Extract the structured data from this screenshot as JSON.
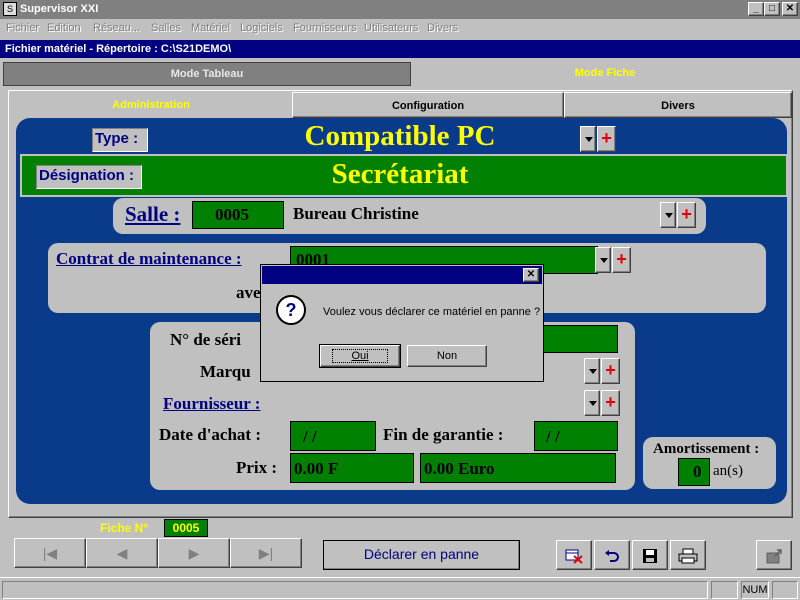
{
  "window": {
    "title": "Supervisor XXI"
  },
  "menu": [
    "Fichier",
    "Edition",
    "Réseau...",
    "Salles",
    "Matériel",
    "Logiciels",
    "Fournisseurs",
    "Utilisateurs",
    "Divers"
  ],
  "path": "Fichier matériel - Répertoire : C:\\S21DEMO\\",
  "mode_tabs": {
    "tableau": "Mode Tableau",
    "fiche": "Mode Fiche",
    "active": "fiche"
  },
  "sub_tabs": {
    "administration": "Administration",
    "configuration": "Configuration",
    "divers": "Divers",
    "active": "administration"
  },
  "form": {
    "type_label": "Type :",
    "type_value": "Compatible PC",
    "designation_label": "Désignation :",
    "designation_value": "Secrétariat",
    "salle_label": "Salle :",
    "salle_code": "0005",
    "salle_name": "Bureau Christine",
    "contrat_label": "Contrat de maintenance :",
    "contrat_value": "0001",
    "avec_label": "ave",
    "serie_label": "N° de séri",
    "marque_label": "Marqu",
    "fournisseur_label": "Fournisseur :",
    "date_achat_label": "Date d'achat :",
    "date_achat_value": "/ /",
    "fin_garantie_label": "Fin de garantie :",
    "fin_garantie_value": "/ /",
    "prix_label": "Prix :",
    "prix_franc": "0.00 F",
    "prix_euro": "0.00 Euro",
    "amortissement_label": "Amortissement :",
    "amortissement_value": "0",
    "amortissement_unit": "an(s)",
    "plus_symbol": "+"
  },
  "dialog": {
    "message": "Voulez vous déclarer ce matériel en panne ?",
    "icon_symbol": "?",
    "close_symbol": "✕",
    "yes_label": "Oui",
    "no_label": "Non"
  },
  "footer": {
    "fiche_label": "Fiche N°",
    "fiche_number": "0005",
    "nav_first": "|◀",
    "nav_prev": "◀",
    "nav_next": "▶",
    "nav_last": "▶|",
    "panne_button": "Déclarer en panne",
    "tools": [
      "delete-record-icon",
      "undo-icon",
      "save-icon",
      "print-icon"
    ],
    "exit_icon": "exit-icon"
  },
  "status": {
    "num": "NUM"
  },
  "window_buttons": {
    "minimize": "_",
    "maximize": "□",
    "close": "✕"
  }
}
